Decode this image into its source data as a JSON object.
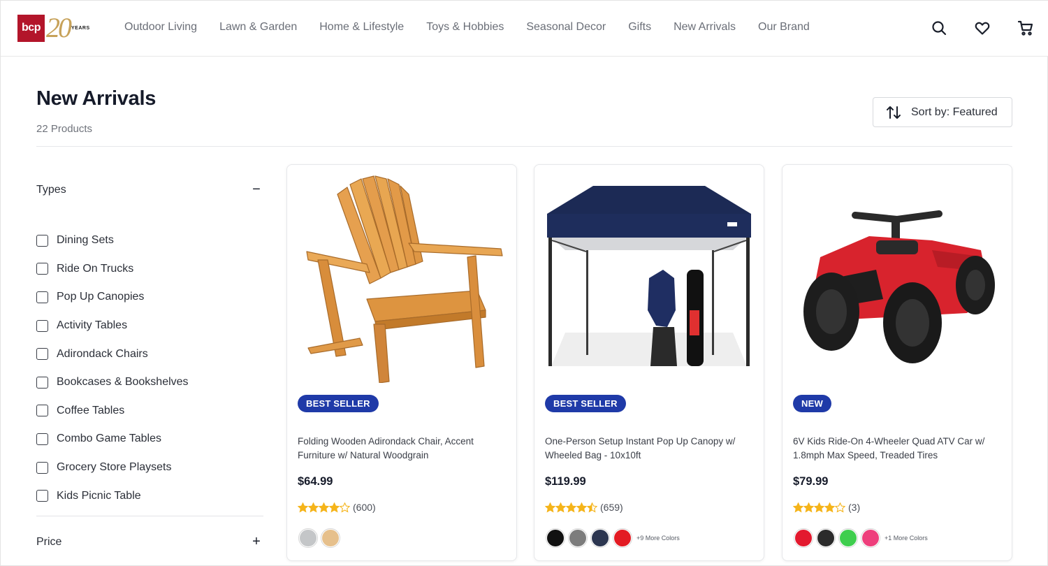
{
  "header": {
    "logo": {
      "brand": "bcp",
      "number": "20",
      "years": "YEARS",
      "brand_color": "#b3152a",
      "gold_color": "#c7a25a"
    },
    "nav": [
      "Outdoor Living",
      "Lawn & Garden",
      "Home & Lifestyle",
      "Toys & Hobbies",
      "Seasonal Decor",
      "Gifts",
      "New Arrivals",
      "Our Brand"
    ],
    "icons": [
      "search-icon",
      "heart-icon",
      "cart-icon"
    ]
  },
  "page": {
    "title": "New Arrivals",
    "count": "22 Products",
    "sort_label": "Sort by: Featured"
  },
  "sidebar": {
    "types": {
      "title": "Types",
      "toggle": "−",
      "items": [
        "Dining Sets",
        "Ride On Trucks",
        "Pop Up Canopies",
        "Activity Tables",
        "Adirondack Chairs",
        "Bookcases & Bookshelves",
        "Coffee Tables",
        "Combo Game Tables",
        "Grocery Store Playsets",
        "Kids Picnic Table"
      ]
    },
    "price": {
      "title": "Price",
      "toggle": "+"
    }
  },
  "products": [
    {
      "badge": "BEST SELLER",
      "name": "Folding Wooden Adirondack Chair, Accent Furniture w/ Natural Woodgrain",
      "price": "$64.99",
      "rating": 4,
      "rating_count": "(600)",
      "colors": [
        "#c4c6c8",
        "#e6c08c"
      ],
      "more_colors": ""
    },
    {
      "badge": "BEST SELLER",
      "name": "One-Person Setup Instant Pop Up Canopy w/ Wheeled Bag - 10x10ft",
      "price": "$119.99",
      "rating": 4.5,
      "rating_count": "(659)",
      "colors": [
        "#111111",
        "#7c7c7c",
        "#2c3650",
        "#e31b23"
      ],
      "more_colors": "+9 More Colors"
    },
    {
      "badge": "NEW",
      "name": "6V Kids Ride-On 4-Wheeler Quad ATV Car w/ 1.8mph Max Speed, Treaded Tires",
      "price": "$79.99",
      "rating": 4,
      "rating_count": "(3)",
      "colors": [
        "#e3192e",
        "#2b2b2b",
        "#3fce4e",
        "#ee3f7c"
      ],
      "more_colors": "+1 More Colors"
    }
  ],
  "colors": {
    "badge_bg": "#1f3aa8",
    "star": "#f5b41a"
  }
}
